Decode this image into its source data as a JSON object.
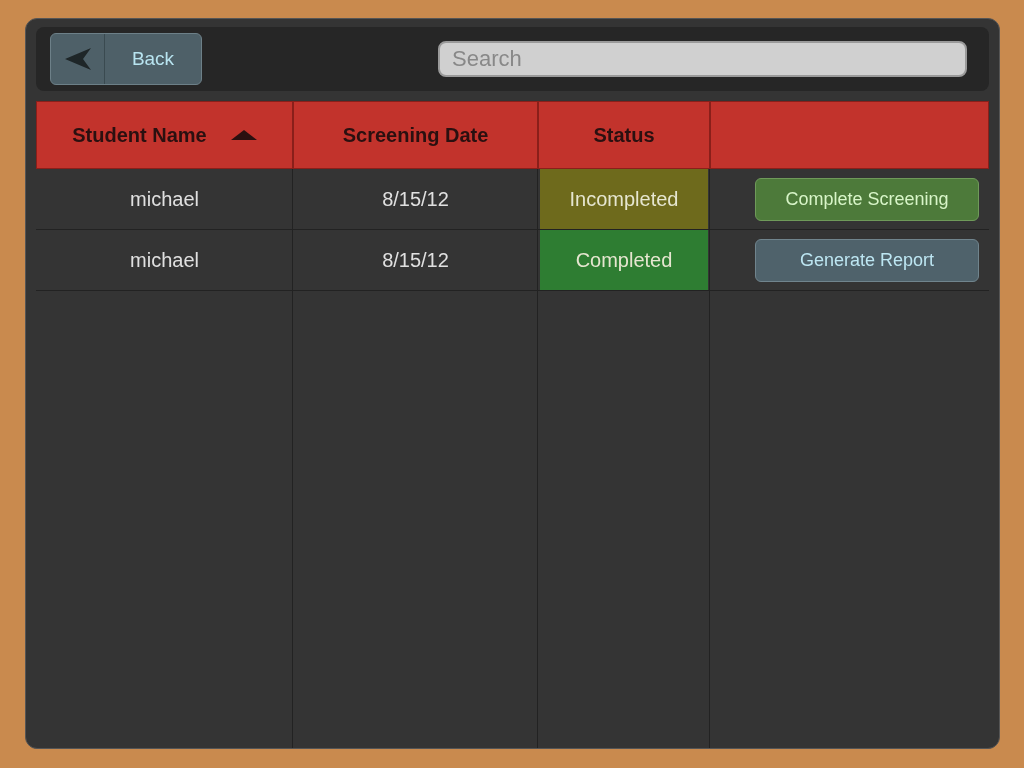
{
  "toolbar": {
    "back_button": "Back",
    "search": {
      "placeholder": "Search"
    }
  },
  "table": {
    "columns": [
      {
        "label": "Student Name",
        "sorted": true
      },
      {
        "label": "Screening Date",
        "sorted": false
      },
      {
        "label": "Status",
        "sorted": false
      }
    ],
    "rows": [
      {
        "name": "michael",
        "date": "8/15/12",
        "status": {
          "label": "Incompleted",
          "color": "#6e6a1c"
        },
        "action": {
          "kind": "complete",
          "label": "Complete Screening"
        }
      },
      {
        "name": "michael",
        "date": "8/15/12",
        "status": {
          "label": "Completed",
          "color": "#2e7d32"
        },
        "action": {
          "kind": "report",
          "label": "Generate Report"
        }
      }
    ]
  }
}
